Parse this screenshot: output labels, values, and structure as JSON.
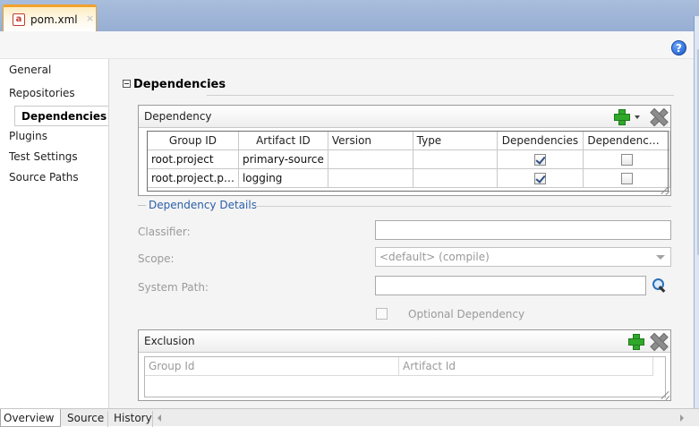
{
  "document_tab": {
    "icon": "maven-file-icon",
    "icon_glyph": "a",
    "title": "pom.xml",
    "close_glyph": "×"
  },
  "help_glyph": "?",
  "nav": {
    "items": [
      {
        "label": "General",
        "active": false
      },
      {
        "label": "Repositories",
        "active": false
      },
      {
        "label": "Dependencies",
        "active": true
      },
      {
        "label": "Plugins",
        "active": false
      },
      {
        "label": "Test Settings",
        "active": false
      },
      {
        "label": "Source Paths",
        "active": false
      }
    ]
  },
  "main": {
    "section_title": "Dependencies",
    "dependency_panel": {
      "title": "Dependency",
      "columns": [
        "Group ID",
        "Artifact ID",
        "Version",
        "Type",
        "Dependencies",
        "Dependenc…"
      ],
      "rows": [
        {
          "group_id": "root.project",
          "artifact_id": "primary-source",
          "version": "",
          "type": "",
          "dependencies_checked": true,
          "dependenc_checked": false
        },
        {
          "group_id": "root.project.p…",
          "artifact_id": "logging",
          "version": "",
          "type": "",
          "dependencies_checked": true,
          "dependenc_checked": false
        }
      ]
    },
    "details": {
      "legend": "Dependency Details",
      "classifier_label": "Classifier:",
      "classifier_value": "",
      "scope_label": "Scope:",
      "scope_value": "<default> (compile)",
      "system_path_label": "System Path:",
      "system_path_value": "",
      "optional_label": "Optional Dependency",
      "optional_checked": false
    },
    "exclusion_panel": {
      "title": "Exclusion",
      "columns": [
        "Group Id",
        "Artifact Id"
      ]
    }
  },
  "bottom_tabs": [
    {
      "label": "Overview",
      "active": true
    },
    {
      "label": "Source",
      "active": false
    },
    {
      "label": "History",
      "active": false
    }
  ],
  "colors": {
    "tab_strip": "#a9bddc",
    "tab_accent": "#f2a12a",
    "legend_blue": "#2a5ea8",
    "add_green": "#2fa82a"
  }
}
